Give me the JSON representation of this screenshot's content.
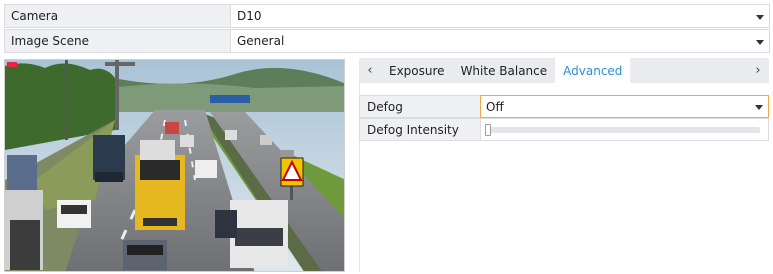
{
  "camera": {
    "label": "Camera",
    "value": "D10"
  },
  "image_scene": {
    "label": "Image Scene",
    "value": "General"
  },
  "tabs": {
    "items": [
      "Exposure",
      "White Balance",
      "Advanced"
    ],
    "active": "Advanced"
  },
  "advanced": {
    "defog": {
      "label": "Defog",
      "value": "Off"
    },
    "defog_intensity": {
      "label": "Defog Intensity",
      "level": 0
    }
  },
  "colors": {
    "accent": "#2f8fd6",
    "focus_border": "#f0a84a",
    "label_bg": "#eef0f3"
  }
}
